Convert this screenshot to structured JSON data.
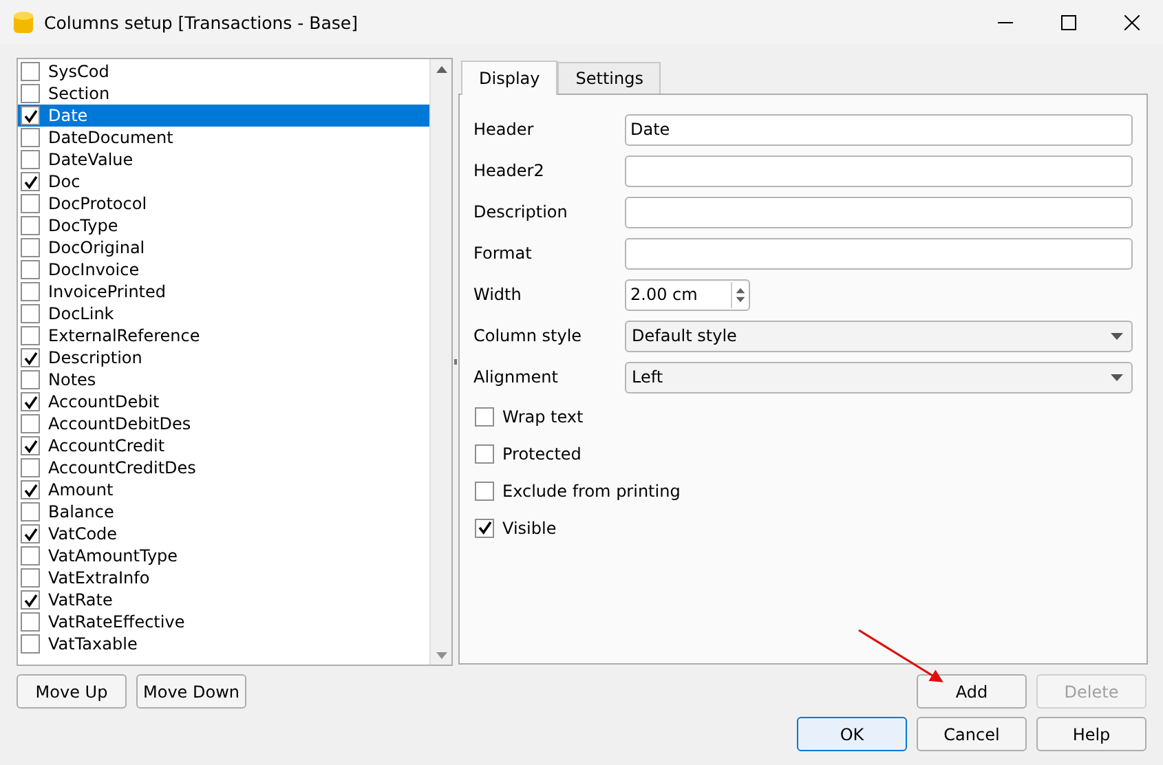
{
  "window": {
    "title": "Columns setup [Transactions - Base]"
  },
  "columns": [
    {
      "label": "SysCod",
      "checked": false,
      "selected": false
    },
    {
      "label": "Section",
      "checked": false,
      "selected": false
    },
    {
      "label": "Date",
      "checked": true,
      "selected": true
    },
    {
      "label": "DateDocument",
      "checked": false,
      "selected": false
    },
    {
      "label": "DateValue",
      "checked": false,
      "selected": false
    },
    {
      "label": "Doc",
      "checked": true,
      "selected": false
    },
    {
      "label": "DocProtocol",
      "checked": false,
      "selected": false
    },
    {
      "label": "DocType",
      "checked": false,
      "selected": false
    },
    {
      "label": "DocOriginal",
      "checked": false,
      "selected": false
    },
    {
      "label": "DocInvoice",
      "checked": false,
      "selected": false
    },
    {
      "label": "InvoicePrinted",
      "checked": false,
      "selected": false
    },
    {
      "label": "DocLink",
      "checked": false,
      "selected": false
    },
    {
      "label": "ExternalReference",
      "checked": false,
      "selected": false
    },
    {
      "label": "Description",
      "checked": true,
      "selected": false
    },
    {
      "label": "Notes",
      "checked": false,
      "selected": false
    },
    {
      "label": "AccountDebit",
      "checked": true,
      "selected": false
    },
    {
      "label": "AccountDebitDes",
      "checked": false,
      "selected": false
    },
    {
      "label": "AccountCredit",
      "checked": true,
      "selected": false
    },
    {
      "label": "AccountCreditDes",
      "checked": false,
      "selected": false
    },
    {
      "label": "Amount",
      "checked": true,
      "selected": false
    },
    {
      "label": "Balance",
      "checked": false,
      "selected": false
    },
    {
      "label": "VatCode",
      "checked": true,
      "selected": false
    },
    {
      "label": "VatAmountType",
      "checked": false,
      "selected": false
    },
    {
      "label": "VatExtraInfo",
      "checked": false,
      "selected": false
    },
    {
      "label": "VatRate",
      "checked": true,
      "selected": false
    },
    {
      "label": "VatRateEffective",
      "checked": false,
      "selected": false
    },
    {
      "label": "VatTaxable",
      "checked": false,
      "selected": false
    }
  ],
  "list_buttons": [
    {
      "label": "Move Up",
      "disabled": false
    },
    {
      "label": "Move Down",
      "disabled": false
    }
  ],
  "tabs": [
    {
      "label": "Display",
      "selected": true
    },
    {
      "label": "Settings",
      "selected": false
    }
  ],
  "fields": [
    {
      "kind": "text",
      "label": "Header",
      "value": "Date"
    },
    {
      "kind": "text",
      "label": "Header2"
    },
    {
      "kind": "text",
      "label": "Description"
    },
    {
      "kind": "text",
      "label": "Format"
    },
    {
      "kind": "spin",
      "label": "Width",
      "value": "2.00 cm"
    },
    {
      "kind": "combo",
      "label": "Column style",
      "value": "Default style"
    },
    {
      "kind": "combo",
      "label": "Alignment",
      "value": "Left"
    }
  ],
  "options": [
    {
      "label": "Wrap text",
      "checked": false
    },
    {
      "label": "Protected",
      "checked": false
    },
    {
      "label": "Exclude from printing",
      "checked": false
    },
    {
      "label": "Visible",
      "checked": true
    }
  ],
  "column_buttons": [
    {
      "label": "Add",
      "disabled": false
    },
    {
      "label": "Delete",
      "disabled": true
    }
  ],
  "dialog_buttons": [
    {
      "label": "OK",
      "default": true
    },
    {
      "label": "Cancel",
      "default": false
    },
    {
      "label": "Help",
      "default": false
    }
  ]
}
